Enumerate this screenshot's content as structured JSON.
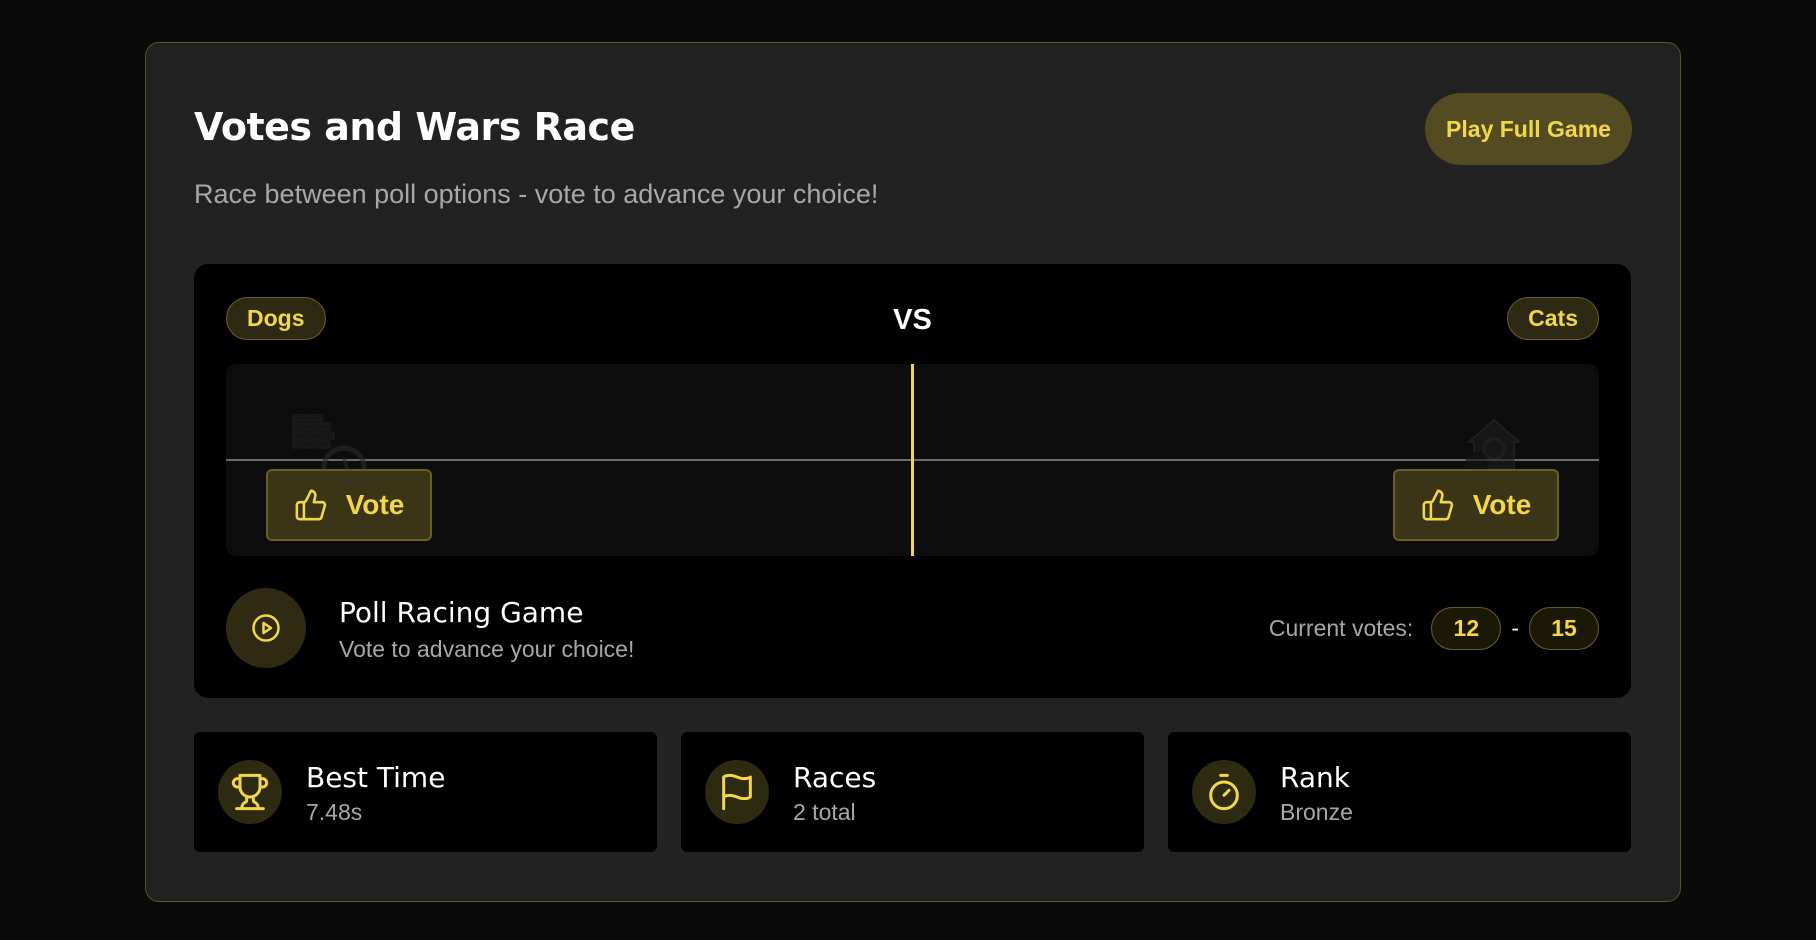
{
  "header": {
    "title": "Votes and Wars Race",
    "subtitle": "Race between poll options - vote to advance your choice!",
    "play_button": "Play Full Game"
  },
  "race": {
    "left_option": "Dogs",
    "right_option": "Cats",
    "vs_label": "VS",
    "vote_left_label": "Vote",
    "vote_right_label": "Vote"
  },
  "game": {
    "title": "Poll Racing Game",
    "subtitle": "Vote to advance your choice!",
    "votes_label": "Current votes:",
    "left_votes": "12",
    "separator": "-",
    "right_votes": "15"
  },
  "stats": [
    {
      "label": "Best Time",
      "value": "7.48s",
      "icon": "trophy-icon"
    },
    {
      "label": "Races",
      "value": "2 total",
      "icon": "flag-icon"
    },
    {
      "label": "Rank",
      "value": "Bronze",
      "icon": "stopwatch-icon"
    }
  ],
  "colors": {
    "accent": "#f2d64b",
    "background": "#0a0a0a",
    "card": "#222222",
    "panel": "#000000"
  }
}
